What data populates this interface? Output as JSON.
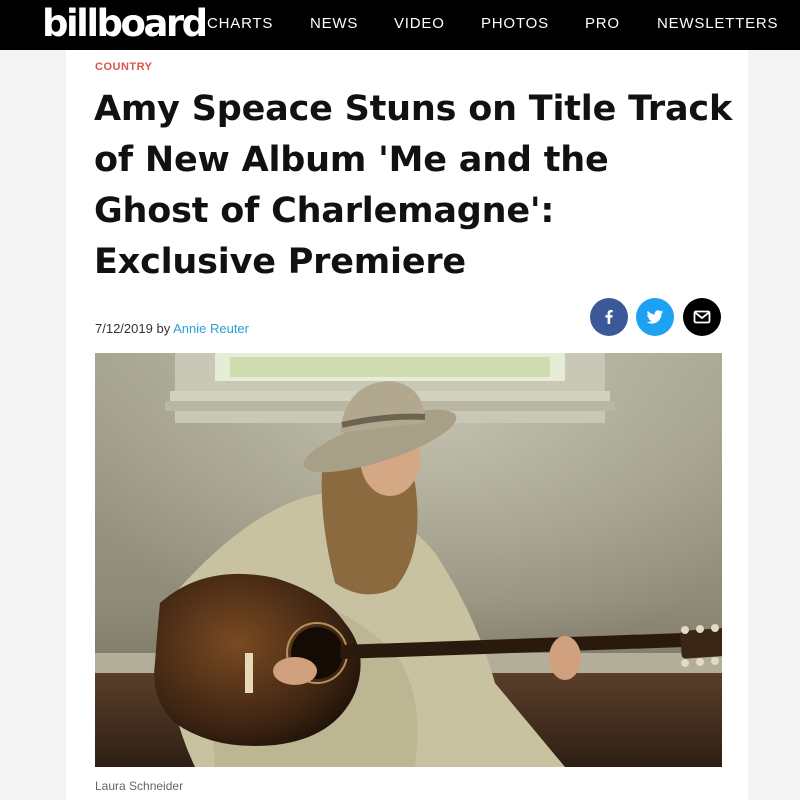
{
  "brand": {
    "logo": "billboard"
  },
  "nav": {
    "items": [
      "CHARTS",
      "NEWS",
      "VIDEO",
      "PHOTOS",
      "PRO",
      "NEWSLETTERS"
    ]
  },
  "article": {
    "category": "COUNTRY",
    "title": "Amy Speace Stuns on Title Track of New Album 'Me and the Ghost of Charlemagne': Exclusive Premiere",
    "date": "7/12/2019",
    "by": "by",
    "author": "Annie Reuter",
    "photo_credit": "Laura Schneider"
  },
  "share": {
    "icons": [
      "facebook-icon",
      "twitter-icon",
      "email-icon"
    ]
  },
  "colors": {
    "category": "#d9534f",
    "author_link": "#2a9fd8",
    "facebook": "#3b5998",
    "twitter": "#1da1f2",
    "email": "#000000",
    "nav_bg": "#000000"
  }
}
